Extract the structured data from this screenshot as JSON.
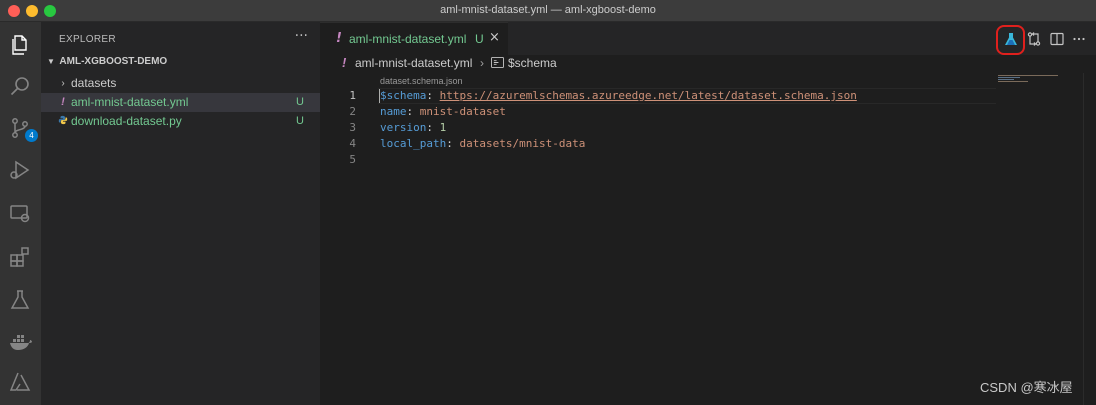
{
  "window": {
    "title": "aml-mnist-dataset.yml — aml-xgboost-demo"
  },
  "activity_bar": {
    "items": [
      {
        "icon": "files-icon"
      },
      {
        "icon": "search-icon"
      },
      {
        "icon": "source-control-icon",
        "badge": "4"
      },
      {
        "icon": "run-debug-icon"
      },
      {
        "icon": "remote-explorer-icon"
      },
      {
        "icon": "extensions-icon"
      },
      {
        "icon": "testing-flask-icon"
      },
      {
        "icon": "docker-icon"
      },
      {
        "icon": "azure-icon"
      }
    ]
  },
  "sidebar": {
    "header": "EXPLORER",
    "more": "···",
    "folder": "AML-XGBOOST-DEMO",
    "items": [
      {
        "name": "datasets",
        "type": "folder",
        "status": ""
      },
      {
        "name": "aml-mnist-dataset.yml",
        "type": "yaml",
        "status": "U",
        "selected": true
      },
      {
        "name": "download-dataset.py",
        "type": "python",
        "status": "U"
      }
    ]
  },
  "tab": {
    "name": "aml-mnist-dataset.yml",
    "status": "U",
    "close": "×"
  },
  "breadcrumb": {
    "file": "aml-mnist-dataset.yml",
    "symbol": "$schema"
  },
  "codelens": "dataset.schema.json",
  "code": {
    "line_numbers": [
      "1",
      "2",
      "3",
      "4",
      "5"
    ],
    "lines": [
      {
        "key": "$schema",
        "sep": ": ",
        "value": "https://azuremlschemas.azureedge.net/latest/dataset.schema.json",
        "kind": "url"
      },
      {
        "key": "name",
        "sep": ": ",
        "value": "mnist-dataset",
        "kind": "str"
      },
      {
        "key": "version",
        "sep": ": ",
        "value": "1",
        "kind": "num"
      },
      {
        "key": "local_path",
        "sep": ": ",
        "value": "datasets/mnist-data",
        "kind": "str"
      },
      {
        "key": "",
        "sep": "",
        "value": "",
        "kind": "empty"
      }
    ]
  },
  "editor_actions": [
    "azure-ml-icon",
    "compare-changes-icon",
    "split-editor-icon",
    "more-actions-icon"
  ],
  "watermark": "CSDN @寒冰屋",
  "colors": {
    "accent_highlight": "#e0201d",
    "aml_icon": "#3ab7d8",
    "untracked": "#73c991",
    "yaml_key": "#569cd6",
    "yaml_string": "#ce9178",
    "yaml_number": "#b5cea8"
  }
}
